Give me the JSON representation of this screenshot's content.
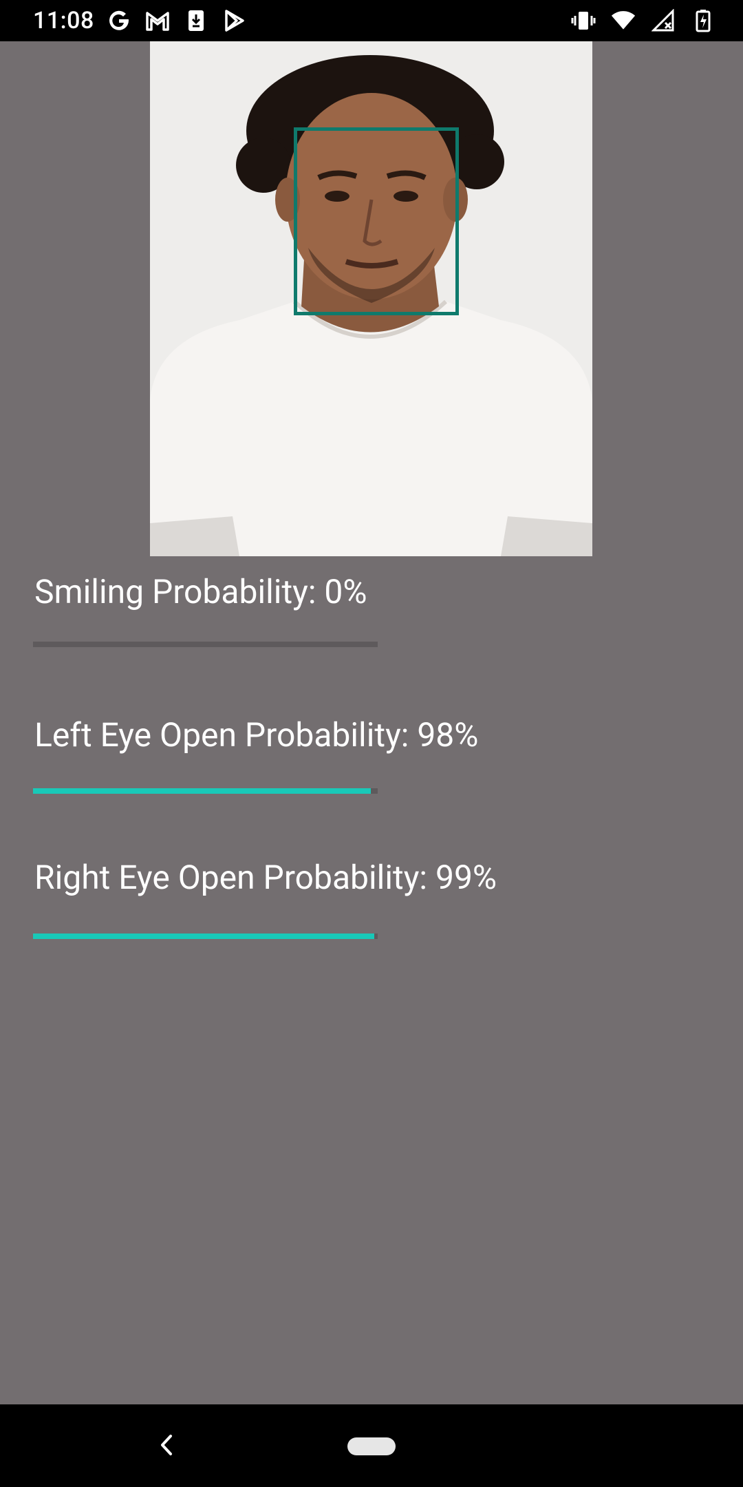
{
  "status_bar": {
    "time": "11:08",
    "left_icons": [
      "google-g-icon",
      "gmail-icon",
      "download-icon",
      "play-store-icon"
    ],
    "right_icons": [
      "vibrate-icon",
      "wifi-icon",
      "signal-off-icon",
      "battery-charging-icon"
    ]
  },
  "photo": {
    "subject": "portrait-with-face-detection",
    "face_box_color": "#0f7a6c"
  },
  "metrics": {
    "smiling": {
      "label": "Smiling Probability: 0%",
      "value": 0.0
    },
    "left_eye": {
      "label": "Left Eye Open Probability: 98%",
      "value": 0.98
    },
    "right_eye": {
      "label": "Right Eye Open Probability: 99%",
      "value": 0.99
    }
  },
  "colors": {
    "background": "#736e70",
    "accent": "#19c9b8",
    "track": "#5e5a5c"
  },
  "nav_bar": {
    "icons": [
      "back-icon",
      "home-pill-icon"
    ]
  }
}
